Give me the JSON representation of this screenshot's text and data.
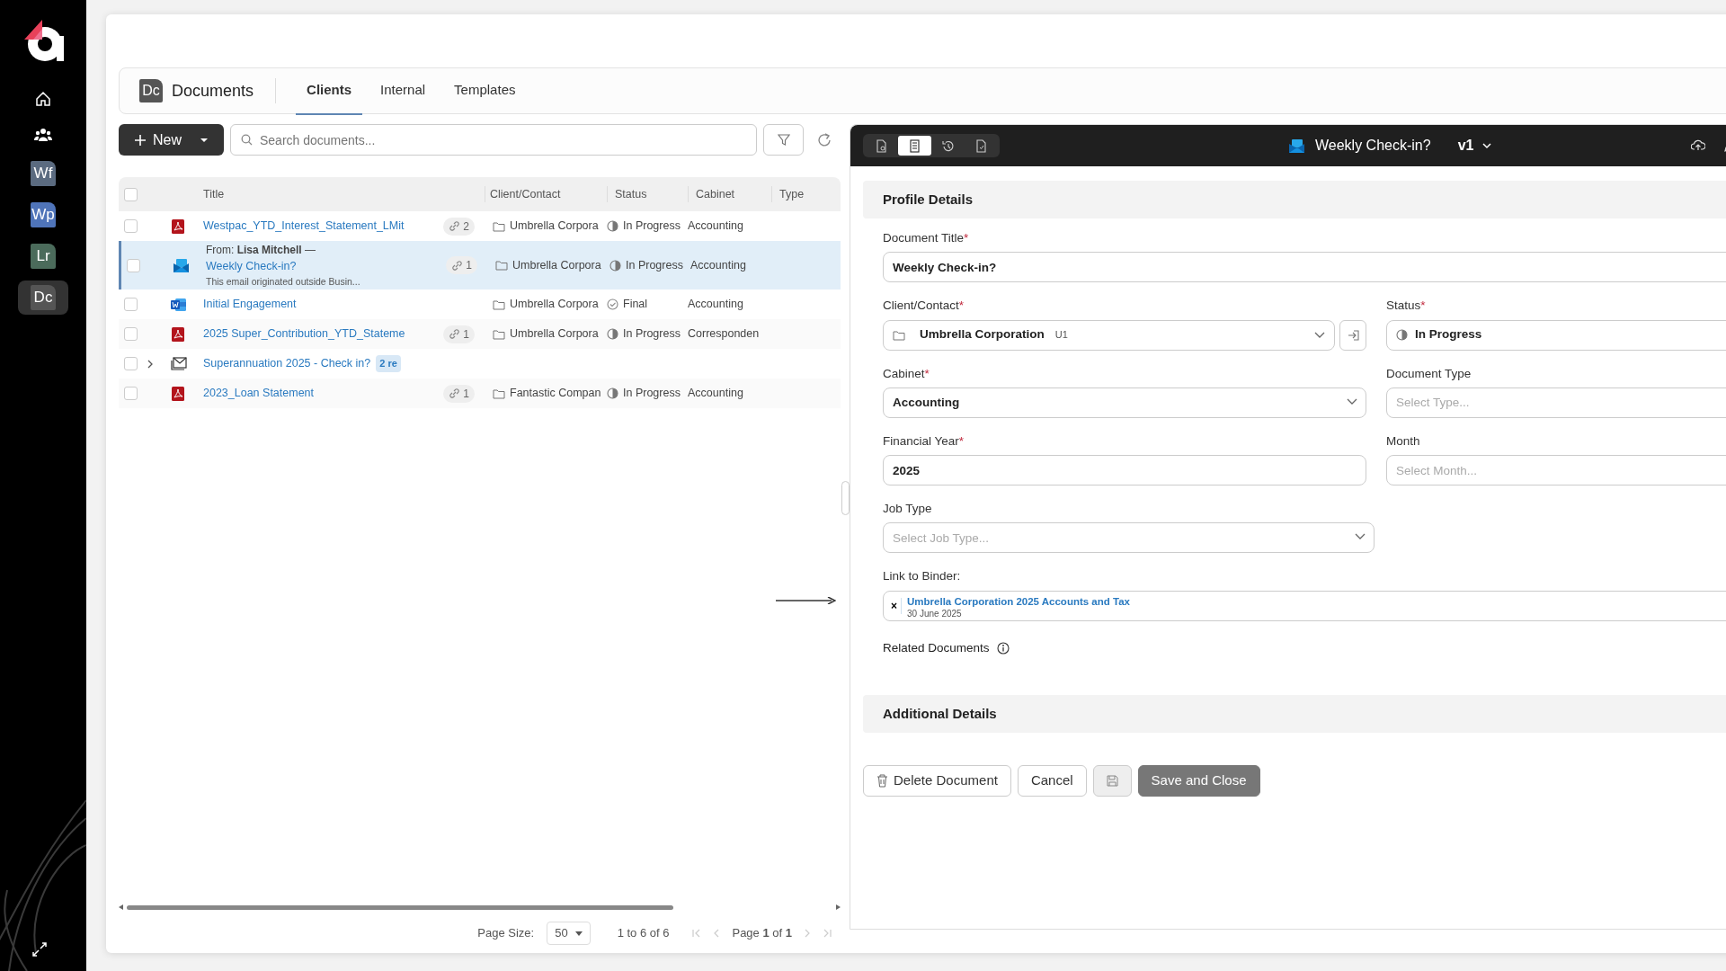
{
  "sidebar": {
    "apps": [
      {
        "label": "Wf",
        "color": "#5b6b80",
        "selected": false
      },
      {
        "label": "Wp",
        "color": "#4f74b9",
        "selected": false
      },
      {
        "label": "Lr",
        "color": "#4b6b5b",
        "selected": false
      },
      {
        "label": "Dc",
        "color": "#555555",
        "selected": true
      }
    ]
  },
  "header": {
    "badge": "Dc",
    "title": "Documents",
    "tabs": [
      {
        "label": "Clients",
        "selected": true
      },
      {
        "label": "Internal",
        "selected": false
      },
      {
        "label": "Templates",
        "selected": false
      }
    ]
  },
  "toolbar": {
    "new_button": "New",
    "search_placeholder": "Search documents..."
  },
  "table": {
    "select_all_checked": false,
    "columns": [
      "Title",
      "Client/Contact",
      "Status",
      "Cabinet",
      "Type"
    ],
    "rows": [
      {
        "kind": "pdf",
        "title": "Westpac_YTD_Interest_Statement_LMit",
        "links": "2",
        "client": "Umbrella Corpora",
        "status": {
          "kind": "progress",
          "text": "In Progress"
        },
        "cabinet": "Accounting",
        "checked": false,
        "selected": false
      },
      {
        "kind": "email",
        "from": "From: **Lisa Mitchell** —",
        "title": "Weekly Check-in?",
        "snippet": "This email originated outside Busin...",
        "links": "1",
        "client": "Umbrella Corpora",
        "status": {
          "kind": "progress",
          "text": "In Progress"
        },
        "cabinet": "Accounting",
        "checked": false,
        "selected": true
      },
      {
        "kind": "word",
        "title": "Initial Engagement",
        "client": "Umbrella Corpora",
        "status": {
          "kind": "final",
          "text": "Final"
        },
        "cabinet": "Accounting",
        "checked": false,
        "selected": false
      },
      {
        "kind": "pdf",
        "title": "2025 Super_Contribution_YTD_Stateme",
        "links": "1",
        "client": "Umbrella Corpora",
        "status": {
          "kind": "progress",
          "text": "In Progress"
        },
        "cabinet": "Corresponden",
        "checked": false,
        "selected": false
      },
      {
        "kind": "thread",
        "title": "Superannuation 2025 - Check in?",
        "replies": "2 re",
        "expanded": false,
        "checked": false,
        "selected": false
      },
      {
        "kind": "pdf",
        "title": "2023_Loan Statement",
        "links": "1",
        "client": "Fantastic Compan",
        "status": {
          "kind": "progress",
          "text": "In Progress"
        },
        "cabinet": "Accounting",
        "checked": false,
        "selected": false
      }
    ]
  },
  "pagination": {
    "page_size_label": "Page Size:",
    "page_size": "50",
    "range": "1 to 6 of 6",
    "page": "Page **1** of **1**"
  },
  "panel": {
    "views": [
      {
        "kind": "preview",
        "selected": false
      },
      {
        "kind": "details",
        "selected": true
      },
      {
        "kind": "history",
        "selected": false
      },
      {
        "kind": "file",
        "selected": false
      }
    ],
    "title": "Weekly Check-in?",
    "version": "v1",
    "sections": [
      {
        "title": "Profile Details",
        "rows": [
          [
            {
              "kind": "text",
              "label": "Document Title",
              "required_mark": "*",
              "value": "Weekly Check-in?"
            }
          ],
          [
            {
              "kind": "client",
              "label": "Client/Contact",
              "required_mark": "*",
              "value": "Umbrella Corporation",
              "code": "U1"
            },
            {
              "kind": "status",
              "label": "Status",
              "required_mark": "*",
              "value": "In Progress"
            }
          ],
          [
            {
              "kind": "select",
              "label": "Cabinet",
              "required_mark": "*",
              "value": "Accounting"
            },
            {
              "kind": "select",
              "label": "Document Type",
              "placeholder": "Select Type..."
            }
          ],
          [
            {
              "kind": "text",
              "label": "Financial Year",
              "required_mark": "*",
              "value": "2025"
            },
            {
              "kind": "select",
              "label": "Month",
              "placeholder": "Select Month..."
            }
          ],
          [
            {
              "kind": "select",
              "label": "Job Type",
              "placeholder": "Select Job Type..."
            }
          ],
          [
            {
              "kind": "binder",
              "label": "Link to Binder:",
              "remove": "×",
              "link": "Umbrella Corporation 2025 Accounts and Tax",
              "date": "30 June 2025"
            }
          ],
          [
            {
              "kind": "info",
              "label": "Related Documents"
            }
          ]
        ]
      },
      {
        "title": "Additional Details"
      }
    ],
    "buttons": [
      {
        "kind": "delete",
        "label": "Delete Document",
        "disabled": false
      },
      {
        "kind": "cancel",
        "label": "Cancel",
        "disabled": false
      },
      {
        "kind": "save",
        "disabled": true
      },
      {
        "kind": "save-close",
        "label": "Save and Close",
        "disabled": true
      }
    ]
  }
}
